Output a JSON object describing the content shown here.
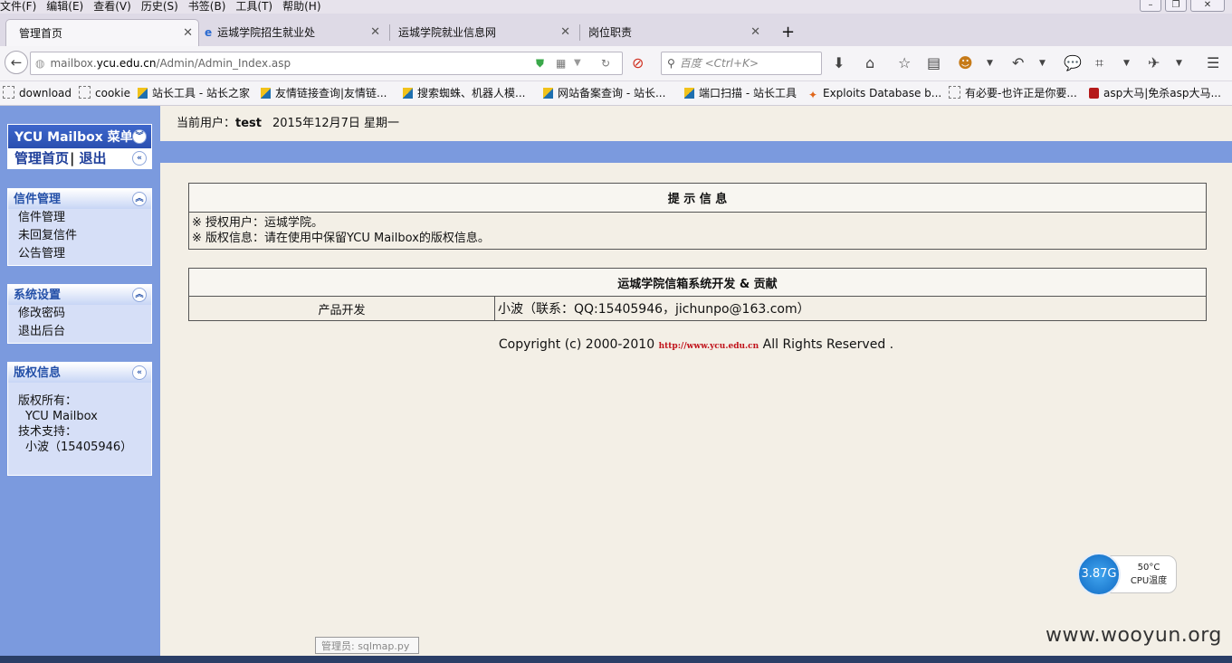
{
  "menubar": [
    "文件(F)",
    "编辑(E)",
    "查看(V)",
    "历史(S)",
    "书签(B)",
    "工具(T)",
    "帮助(H)"
  ],
  "tabs": [
    {
      "label": "管理首页"
    },
    {
      "label": "运城学院招生就业处"
    },
    {
      "label": "运城学院就业信息网"
    },
    {
      "label": "岗位职责"
    }
  ],
  "new_tab": "+",
  "url": {
    "prefix": "mailbox.",
    "domain": "ycu.edu.cn",
    "path": "/Admin/Admin_Index.asp"
  },
  "search_placeholder": "百度 <Ctrl+K>",
  "bookmarks": [
    "download",
    "cookie",
    "站长工具 - 站长之家",
    "友情链接查询|友情链...",
    "搜索蜘蛛、机器人模...",
    "网站备案查询 - 站长...",
    "端口扫描 - 站长工具",
    "Exploits Database b...",
    "有必要-也许正是你要...",
    "asp大马|免杀asp大马..."
  ],
  "sidebar": {
    "menu_title": "YCU Mailbox 菜单",
    "home_link": "管理首页",
    "logout_link": "退出",
    "separator": "|",
    "mail": {
      "title": "信件管理",
      "items": [
        "信件管理",
        "未回复信件",
        "公告管理"
      ]
    },
    "settings": {
      "title": "系统设置",
      "items": [
        "修改密码",
        "退出后台"
      ]
    },
    "copyright": {
      "title": "版权信息",
      "lines": [
        "版权所有：",
        "YCU Mailbox",
        "技术支持：",
        "小波（15405946）"
      ]
    }
  },
  "header": {
    "user_label": "当前用户：",
    "user": "test",
    "date": "2015年12月7日 星期一"
  },
  "notice": {
    "title": "提 示 信 息",
    "lines": [
      "※ 授权用户：运城学院。",
      "※ 版权信息：请在使用中保留YCU Mailbox的版权信息。"
    ]
  },
  "dev": {
    "title": "运城学院信箱系统开发 & 贡献",
    "role": "产品开发",
    "credit": "小波（联系：QQ:15405946，jichunpo@163.com）"
  },
  "copyright": {
    "prefix": "Copyright (c) 2000-2010 ",
    "link": "http://www.ycu.edu.cn",
    "suffix": " All Rights Reserved ."
  },
  "cpu": {
    "freq": "3.87G",
    "temp": "50°C",
    "label": "CPU温度"
  },
  "tooltip": "管理员: sqlmap.py",
  "watermark": "www.wooyun.org",
  "colors": {
    "accent": "#7b9ade",
    "panel": "#d6dff7",
    "title": "#2450a8",
    "link_red": "#c0121a"
  }
}
